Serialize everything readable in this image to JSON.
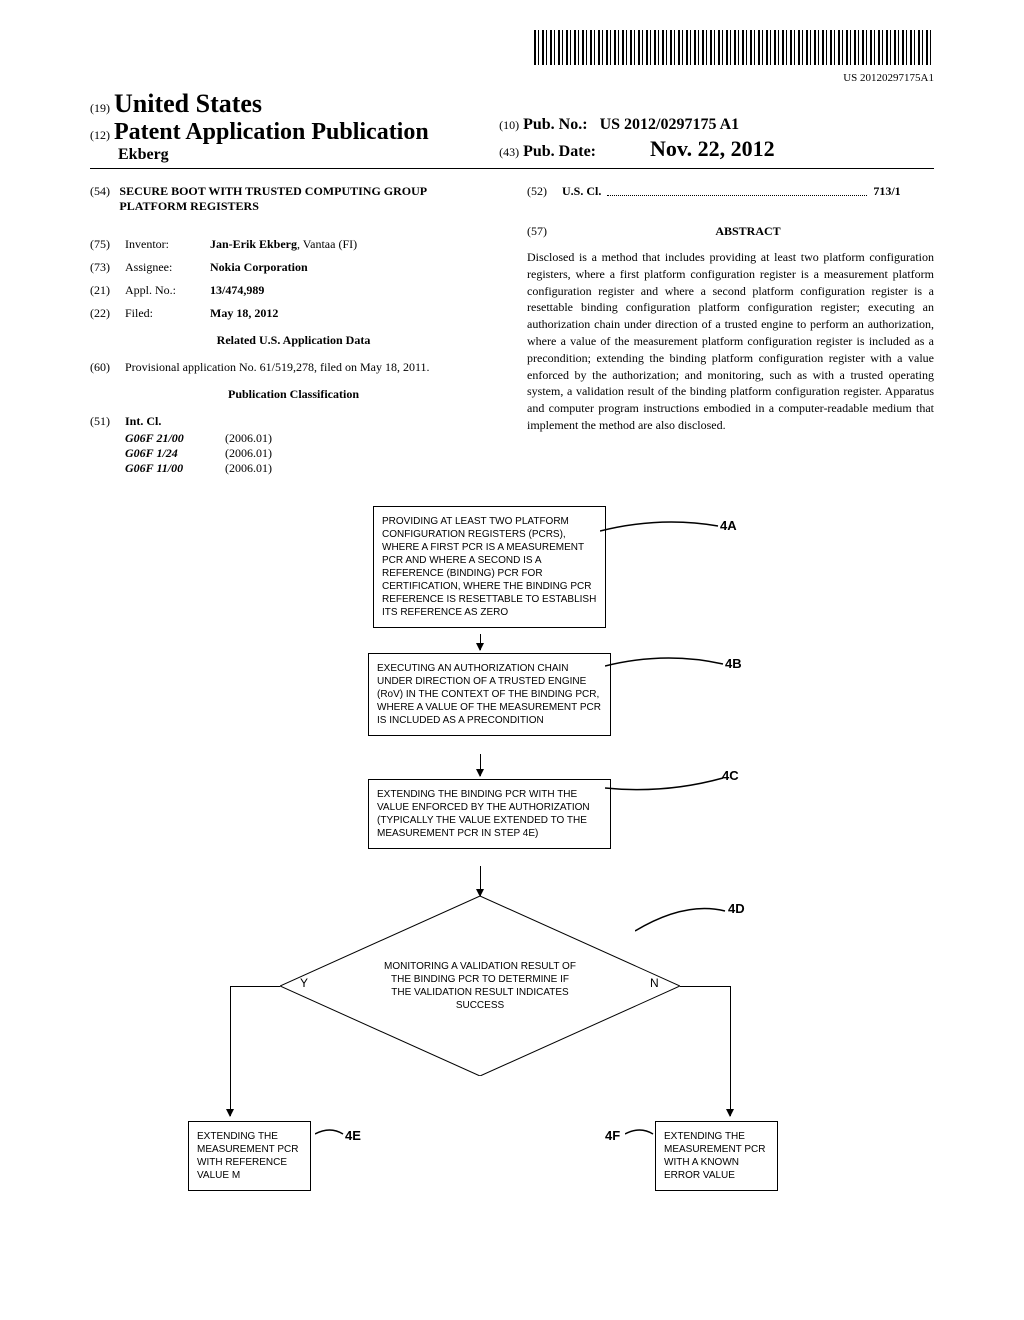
{
  "barcode_text": "US 20120297175A1",
  "header": {
    "country_num": "(19)",
    "country": "United States",
    "pub_num": "(12)",
    "pub_type": "Patent Application Publication",
    "author": "Ekberg",
    "pubno_num": "(10)",
    "pubno_label": "Pub. No.:",
    "pubno_value": "US 2012/0297175 A1",
    "pubdate_num": "(43)",
    "pubdate_label": "Pub. Date:",
    "pubdate_value": "Nov. 22, 2012"
  },
  "title": {
    "num": "(54)",
    "text": "SECURE BOOT WITH TRUSTED COMPUTING GROUP PLATFORM REGISTERS"
  },
  "inventor": {
    "num": "(75)",
    "label": "Inventor:",
    "value": "Jan-Erik Ekberg",
    "location": ", Vantaa (FI)"
  },
  "assignee": {
    "num": "(73)",
    "label": "Assignee:",
    "value": "Nokia Corporation"
  },
  "applno": {
    "num": "(21)",
    "label": "Appl. No.:",
    "value": "13/474,989"
  },
  "filed": {
    "num": "(22)",
    "label": "Filed:",
    "value": "May 18, 2012"
  },
  "related_header": "Related U.S. Application Data",
  "provisional": {
    "num": "(60)",
    "text": "Provisional application No. 61/519,278, filed on May 18, 2011."
  },
  "classification_header": "Publication Classification",
  "intcl": {
    "num": "(51)",
    "label": "Int. Cl.",
    "items": [
      {
        "code": "G06F 21/00",
        "year": "(2006.01)"
      },
      {
        "code": "G06F 1/24",
        "year": "(2006.01)"
      },
      {
        "code": "G06F 11/00",
        "year": "(2006.01)"
      }
    ]
  },
  "uscl": {
    "num": "(52)",
    "label": "U.S. Cl.",
    "value": "713/1"
  },
  "abstract": {
    "num": "(57)",
    "header": "ABSTRACT",
    "text": "Disclosed is a method that includes providing at least two platform configuration registers, where a first platform configuration register is a measurement platform configuration register and where a second platform configuration register is a resettable binding configuration platform configuration register; executing an authorization chain under direction of a trusted engine to perform an authorization, where a value of the measurement platform configuration register is included as a precondition; extending the binding platform configuration register with a value enforced by the authorization; and monitoring, such as with a trusted operating system, a validation result of the binding platform configuration register. Apparatus and computer program instructions embodied in a computer-readable medium that implement the method are also disclosed."
  },
  "flowchart": {
    "box_4a": "PROVIDING AT LEAST TWO PLATFORM CONFIGURATION REGISTERS (PCRS), WHERE A FIRST PCR IS A MEASUREMENT PCR AND WHERE A SECOND IS A REFERENCE (BINDING) PCR FOR CERTIFICATION, WHERE THE BINDING PCR REFERENCE IS RESETTABLE TO ESTABLISH ITS REFERENCE AS ZERO",
    "label_4a": "4A",
    "box_4b": "EXECUTING AN AUTHORIZATION CHAIN UNDER DIRECTION OF A TRUSTED ENGINE (RoV) IN THE CONTEXT OF THE BINDING PCR, WHERE A VALUE OF THE MEASUREMENT PCR IS INCLUDED AS A PRECONDITION",
    "label_4b": "4B",
    "box_4c": "EXTENDING THE BINDING PCR WITH THE VALUE ENFORCED BY THE AUTHORIZATION (TYPICALLY THE VALUE EXTENDED TO THE MEASUREMENT PCR IN STEP 4E)",
    "label_4c": "4C",
    "diamond_4d": "MONITORING A VALIDATION RESULT OF THE BINDING PCR TO DETERMINE IF THE VALIDATION RESULT INDICATES SUCCESS",
    "label_4d": "4D",
    "box_4e": "EXTENDING THE MEASUREMENT PCR WITH REFERENCE VALUE M",
    "label_4e": "4E",
    "box_4f": "EXTENDING THE MEASUREMENT PCR WITH A KNOWN ERROR VALUE",
    "label_4f": "4F",
    "yes": "Y",
    "no": "N"
  }
}
